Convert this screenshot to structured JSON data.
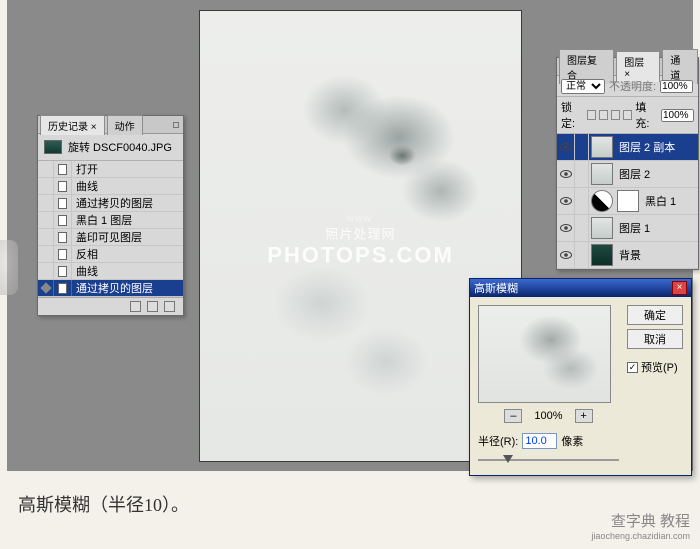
{
  "history": {
    "tab_active": "历史记录 ×",
    "tab_inactive": "动作",
    "doc_name": "旋转 DSCF0040.JPG",
    "items": [
      {
        "label": "打开",
        "selected": false
      },
      {
        "label": "曲线",
        "selected": false
      },
      {
        "label": "通过拷贝的图层",
        "selected": false
      },
      {
        "label": "黑白 1 图层",
        "selected": false
      },
      {
        "label": "盖印可见图层",
        "selected": false
      },
      {
        "label": "反相",
        "selected": false
      },
      {
        "label": "曲线",
        "selected": false
      },
      {
        "label": "通过拷贝的图层",
        "selected": true
      }
    ]
  },
  "layers": {
    "tab1": "图层复合",
    "tab2": "图层 ×",
    "tab3": "通道",
    "blend_label": "正常",
    "opacity_label": "不透明度:",
    "opacity_val": "100%",
    "lock_label": "锁定:",
    "fill_label": "填充:",
    "fill_val": "100%",
    "items": [
      {
        "name": "图层 2 副本",
        "type": "img",
        "selected": true
      },
      {
        "name": "图层 2",
        "type": "img",
        "selected": false
      },
      {
        "name": "黑白 1",
        "type": "adj",
        "selected": false
      },
      {
        "name": "图层 1",
        "type": "img",
        "selected": false
      },
      {
        "name": "背景",
        "type": "bg",
        "selected": false
      }
    ]
  },
  "dialog": {
    "title": "高斯模糊",
    "ok": "确定",
    "cancel": "取消",
    "preview_chk": "预览(P)",
    "zoom": "100%",
    "minus": "–",
    "plus": "+",
    "radius_label": "半径(R):",
    "radius_val": "10.0",
    "radius_unit": "像素"
  },
  "watermark": {
    "cn": "照片处理网",
    "en": "PHOTOPS.COM",
    "sub": "WWW."
  },
  "caption": "高斯模糊（半径10）。",
  "brand": {
    "l1": "查字典 教程",
    "l2": "jiaocheng.chazidian.com"
  }
}
